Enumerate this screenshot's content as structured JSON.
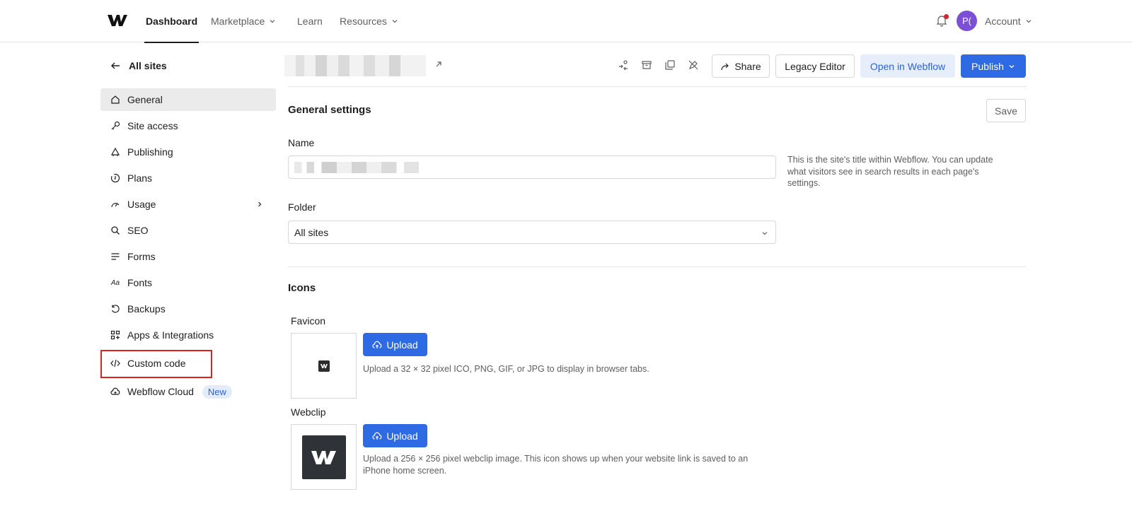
{
  "topnav": {
    "items": [
      {
        "label": "Dashboard",
        "active": true
      },
      {
        "label": "Marketplace",
        "has_dropdown": true
      },
      {
        "label": "Learn"
      },
      {
        "label": "Resources",
        "has_dropdown": true
      }
    ],
    "avatar_initials": "P(",
    "account_label": "Account",
    "notification_dot": true
  },
  "sidebar": {
    "back_label": "All sites",
    "items": [
      {
        "label": "General",
        "icon": "home-icon",
        "selected": true
      },
      {
        "label": "Site access",
        "icon": "key-icon"
      },
      {
        "label": "Publishing",
        "icon": "cloud-publish-icon"
      },
      {
        "label": "Plans",
        "icon": "plans-icon"
      },
      {
        "label": "Usage",
        "icon": "gauge-icon",
        "has_submenu": true
      },
      {
        "label": "SEO",
        "icon": "search-icon"
      },
      {
        "label": "Forms",
        "icon": "forms-icon"
      },
      {
        "label": "Fonts",
        "icon": "fonts-icon"
      },
      {
        "label": "Backups",
        "icon": "backup-icon"
      },
      {
        "label": "Apps & Integrations",
        "icon": "apps-icon"
      },
      {
        "label": "Custom code",
        "icon": "code-icon",
        "highlighted": true
      },
      {
        "label": "Webflow Cloud",
        "icon": "cloud-icon",
        "badge": "New"
      }
    ]
  },
  "toolbar": {
    "share_label": "Share",
    "legacy_label": "Legacy Editor",
    "open_label": "Open in Webflow",
    "publish_label": "Publish"
  },
  "general": {
    "title": "General settings",
    "save_label": "Save",
    "name_label": "Name",
    "name_help": "This is the site's title within Webflow. You can update what visitors see in search results in each page's settings.",
    "folder_label": "Folder",
    "folder_value": "All sites"
  },
  "icons": {
    "title": "Icons",
    "favicon_label": "Favicon",
    "favicon_upload": "Upload",
    "favicon_desc": "Upload a 32 × 32 pixel ICO, PNG, GIF, or JPG to display in browser tabs.",
    "webclip_label": "Webclip",
    "webclip_upload": "Upload",
    "webclip_desc_line1": "Upload a 256 × 256 pixel webclip image. This icon shows up when your website link is saved to an",
    "webclip_desc_line2": "iPhone home screen."
  },
  "colors": {
    "accent": "#2d6ae3",
    "highlight_border": "#e0201b",
    "avatar_bg": "#7b4fd6",
    "notification": "#d1242f"
  }
}
